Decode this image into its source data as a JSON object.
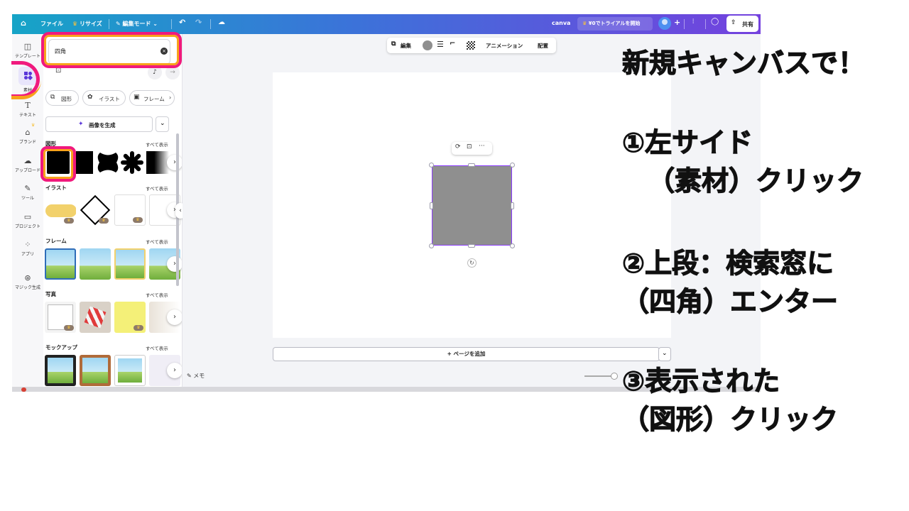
{
  "topbar": {
    "file": "ファイル",
    "resize": "リサイズ",
    "edit_mode": "編集モード",
    "doc_name": "canva",
    "trial": "¥0でトライアルを開始",
    "share": "共有"
  },
  "rail": {
    "items": [
      {
        "label": "テンプレート",
        "icon": "template-icon"
      },
      {
        "label": "素材",
        "icon": "elements-icon"
      },
      {
        "label": "テキスト",
        "icon": "text-icon"
      },
      {
        "label": "ブランド",
        "icon": "brand-icon"
      },
      {
        "label": "アップロード",
        "icon": "upload-icon"
      },
      {
        "label": "ツール",
        "icon": "tools-icon"
      },
      {
        "label": "プロジェクト",
        "icon": "folder-icon"
      },
      {
        "label": "アプリ",
        "icon": "apps-icon"
      },
      {
        "label": "マジック生成",
        "icon": "magic-icon"
      }
    ]
  },
  "panel": {
    "search_value": "四角",
    "chips": [
      "図形",
      "イラスト",
      "フレーム"
    ],
    "generate": "画像を生成",
    "see_all": "すべて表示",
    "sections": {
      "shapes": "図形",
      "illust": "イラスト",
      "frames": "フレーム",
      "photos": "写真",
      "mockups": "モックアップ"
    }
  },
  "toolbar": {
    "edit": "編集",
    "animation": "アニメーション",
    "position": "配置"
  },
  "canvas": {
    "add_page": "+ ページを追加",
    "notes": "メモ"
  },
  "instructions": {
    "line1": "新規キャンバスで！",
    "line2": "①左サイド",
    "line3": "（素材）クリック",
    "line4": "②上段：検索窓に",
    "line5": "（四角）エンター",
    "line6": "③表示された",
    "line7": "（図形）クリック"
  },
  "colors": {
    "highlight_pink": "#f0197d",
    "highlight_orange": "#f7a21b",
    "shape_gray": "#8f8f8f",
    "selection_purple": "#8b3dff"
  }
}
